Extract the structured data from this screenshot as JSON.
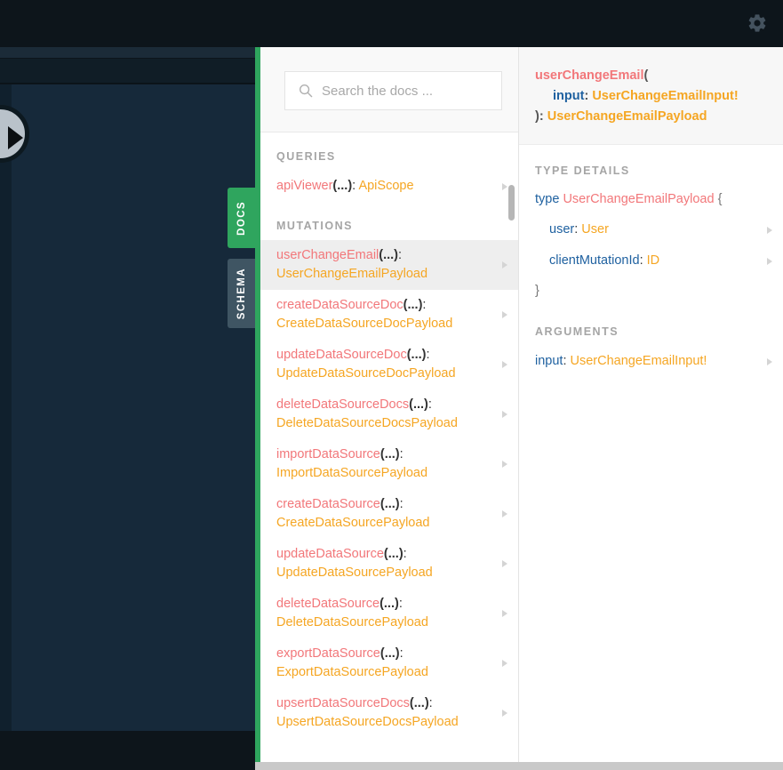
{
  "topbar": {
    "settings_icon": "gear-icon"
  },
  "editor": {
    "execute_icon": "play-icon"
  },
  "side_tabs": [
    {
      "label": "DOCS",
      "active": true,
      "color": "#2fa55e"
    },
    {
      "label": "SCHEMA",
      "active": false,
      "color": "#3f5563"
    }
  ],
  "docs": {
    "search": {
      "placeholder": "Search the docs ...",
      "value": "",
      "icon": "search-icon"
    },
    "sections": [
      {
        "title": "QUERIES",
        "items": [
          {
            "name": "apiViewer",
            "args": "(...)",
            "type": "ApiScope",
            "wrap": false,
            "selected": false
          }
        ]
      },
      {
        "title": "MUTATIONS",
        "items": [
          {
            "name": "userChangeEmail",
            "args": "(...)",
            "type": "UserChangeEmailPayload",
            "wrap": true,
            "selected": true
          },
          {
            "name": "createDataSourceDoc",
            "args": "(...)",
            "type": "CreateDataSourceDocPayload",
            "wrap": true,
            "selected": false
          },
          {
            "name": "updateDataSourceDoc",
            "args": "(...)",
            "type": "UpdateDataSourceDocPayload",
            "wrap": true,
            "selected": false
          },
          {
            "name": "deleteDataSourceDocs",
            "args": "(...)",
            "type": "DeleteDataSourceDocsPayload",
            "wrap": true,
            "selected": false
          },
          {
            "name": "importDataSource",
            "args": "(...)",
            "type": "ImportDataSourcePayload",
            "wrap": true,
            "selected": false
          },
          {
            "name": "createDataSource",
            "args": "(...)",
            "type": "CreateDataSourcePayload",
            "wrap": true,
            "selected": false
          },
          {
            "name": "updateDataSource",
            "args": "(...)",
            "type": "UpdateDataSourcePayload",
            "wrap": true,
            "selected": false
          },
          {
            "name": "deleteDataSource",
            "args": "(...)",
            "type": "DeleteDataSourcePayload",
            "wrap": true,
            "selected": false
          },
          {
            "name": "exportDataSource",
            "args": "(...)",
            "type": "ExportDataSourcePayload",
            "wrap": true,
            "selected": false
          },
          {
            "name": "upsertDataSourceDocs",
            "args": "(...)",
            "type": "UpsertDataSourceDocsPayload",
            "wrap": true,
            "selected": false
          }
        ]
      }
    ]
  },
  "details": {
    "signature": {
      "field_name": "userChangeEmail",
      "open_paren": "(",
      "arg_name": "input",
      "arg_colon": ":",
      "arg_type": "UserChangeEmailInput!",
      "close_paren": ")",
      "return_colon": ":",
      "return_type": "UserChangeEmailPayload"
    },
    "type_details": {
      "title": "TYPE DETAILS",
      "keyword": "type",
      "type_name": "UserChangeEmailPayload",
      "open_brace": "{",
      "close_brace": "}",
      "fields": [
        {
          "name": "user",
          "colon": ":",
          "type": "User"
        },
        {
          "name": "clientMutationId",
          "colon": ":",
          "type": "ID"
        }
      ]
    },
    "arguments": {
      "title": "ARGUMENTS",
      "items": [
        {
          "name": "input",
          "colon": ":",
          "type": "UserChangeEmailInput!"
        }
      ]
    }
  },
  "colors": {
    "accent_green": "#2fa55e",
    "field_red": "#f2777a",
    "type_orange": "#f5a623",
    "arg_blue": "#1f61a0",
    "dark_bg": "#0d151b",
    "editor_bg": "#16293a"
  }
}
